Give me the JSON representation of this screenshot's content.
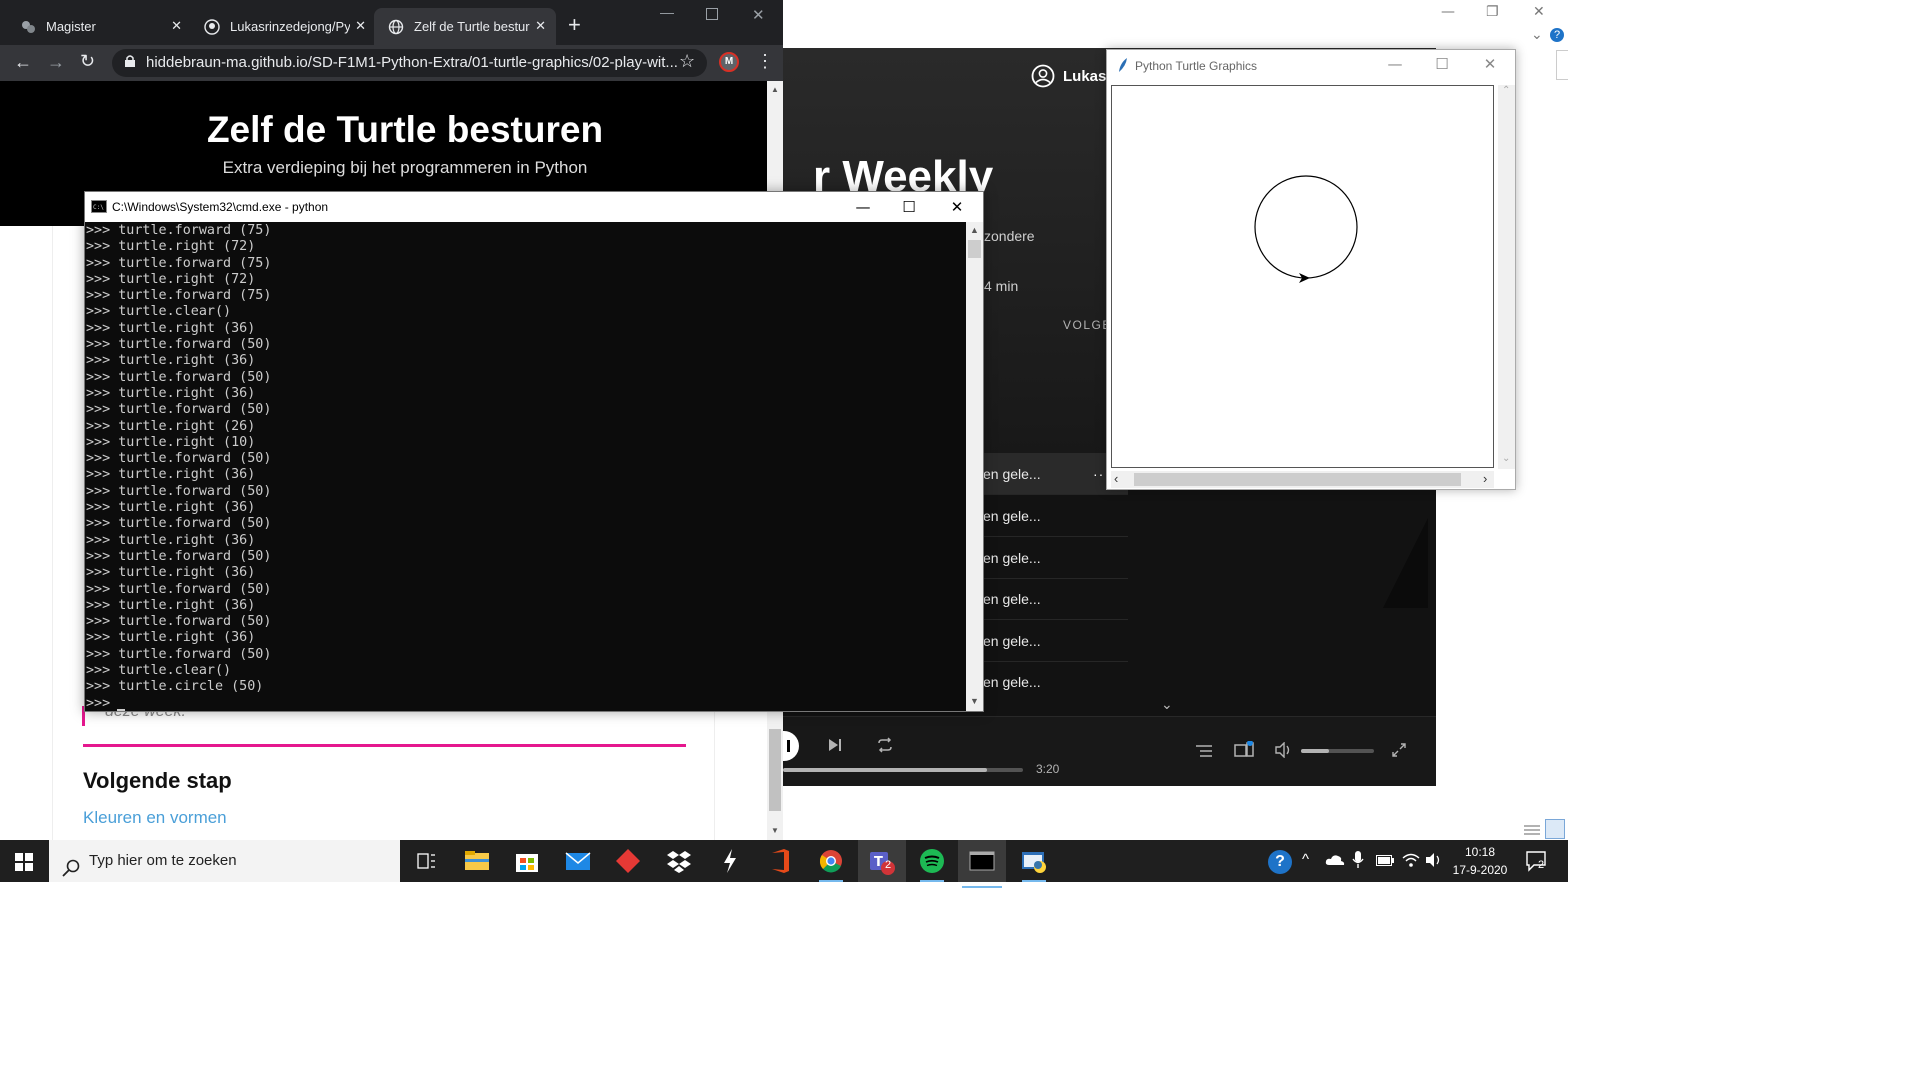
{
  "chrome": {
    "tabs": [
      {
        "label": "Magister",
        "active": false
      },
      {
        "label": "Lukasrinzedejong/Pyt",
        "active": false
      },
      {
        "label": "Zelf de Turtle bestur",
        "active": true
      }
    ],
    "new_tab": "+",
    "url": "hiddebraun-ma.github.io/SD-F1M1-Python-Extra/01-turtle-graphics/02-play-wit...",
    "profile_initial": "M",
    "page": {
      "title": "Zelf de Turtle besturen",
      "subtitle": "Extra verdieping bij het programmeren in Python",
      "partial_text": "deze week.",
      "next_heading": "Volgende stap",
      "next_link": "Kleuren en vormen"
    }
  },
  "cmd": {
    "title": "C:\\Windows\\System32\\cmd.exe - python",
    "lines": [
      ">>> turtle.forward (75)",
      ">>> turtle.right (72)",
      ">>> turtle.forward (75)",
      ">>> turtle.right (72)",
      ">>> turtle.forward (75)",
      ">>> turtle.clear()",
      ">>> turtle.right (36)",
      ">>> turtle.forward (50)",
      ">>> turtle.right (36)",
      ">>> turtle.forward (50)",
      ">>> turtle.right (36)",
      ">>> turtle.forward (50)",
      ">>> turtle.right (26)",
      ">>> turtle.right (10)",
      ">>> turtle.forward (50)",
      ">>> turtle.right (36)",
      ">>> turtle.forward (50)",
      ">>> turtle.right (36)",
      ">>> turtle.forward (50)",
      ">>> turtle.right (36)",
      ">>> turtle.forward (50)",
      ">>> turtle.right (36)",
      ">>> turtle.forward (50)",
      ">>> turtle.right (36)",
      ">>> turtle.forward (50)",
      ">>> turtle.right (36)",
      ">>> turtle.forward (50)",
      ">>> turtle.clear()",
      ">>> turtle.circle (50)",
      ">>> "
    ]
  },
  "turtle_window": {
    "title": "Python Turtle Graphics"
  },
  "spotify": {
    "user": "Lukas",
    "heading_partial": "r Weekly",
    "desc_partial": "zondere",
    "duration_partial": "4 min",
    "column_partial": "VOLGE",
    "track_rows": [
      "en gele...",
      "en gele...",
      "en gele...",
      "en gele...",
      "en gele...",
      "en gele..."
    ],
    "more": "···",
    "time": "3:20",
    "progress": 0.85,
    "volume": 0.38
  },
  "taskbar": {
    "search_placeholder": "Typ hier om te zoeken",
    "clock_time": "10:18",
    "clock_date": "17-9-2020",
    "teams_badge": "2",
    "notif_count": "2"
  },
  "colors": {
    "chrome_dark": "#202124",
    "chrome_tab": "#35363a",
    "accent_pink": "#e5178e",
    "link_blue": "#4a9fd8",
    "spotify_bg": "#121212"
  }
}
